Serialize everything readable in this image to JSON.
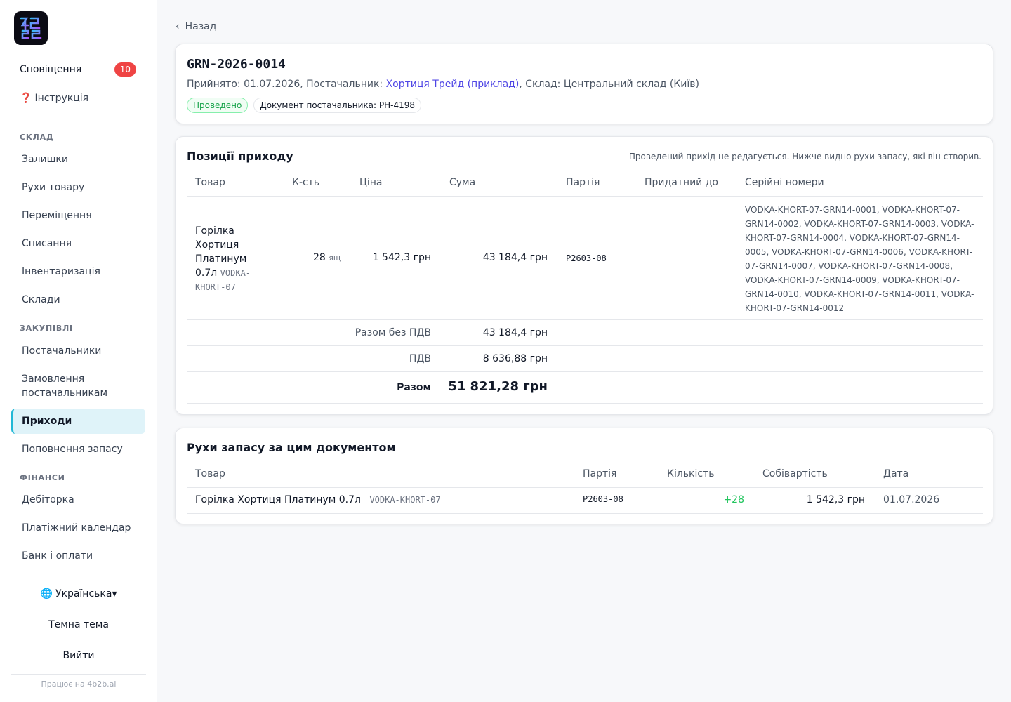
{
  "sidebar": {
    "notifications": {
      "label": "Сповіщення",
      "count": "10"
    },
    "help": {
      "icon": "❓",
      "label": "Інструкція"
    },
    "sections": {
      "warehouse": "СКЛАД",
      "purchasing": "ЗАКУПІВЛІ",
      "finance": "ФІНАНСИ"
    },
    "items": {
      "stock": "Залишки",
      "movements": "Рухи товару",
      "transfers": "Переміщення",
      "writeoffs": "Списання",
      "inventory": "Інвентаризація",
      "warehouses": "Склади",
      "suppliers": "Постачальники",
      "supplier_orders": "Замовлення постачальникам",
      "receipts": "Приходи",
      "replenishment": "Поповнення запасу",
      "receivables": "Дебіторка",
      "payment_calendar": "Платіжний календар",
      "bank": "Банк і оплати"
    },
    "language": "Українська",
    "language_caret": "▾",
    "theme": "Темна тема",
    "logout": "Вийти",
    "powered": "Працює на 4b2b.ai"
  },
  "back": "Назад",
  "document": {
    "title": "GRN-2026-0014",
    "meta_prefix": "Прийнято: 01.07.2026, Постачальник: ",
    "supplier": "Хортиця Трейд (приклад)",
    "meta_suffix": ", Склад: Центральний склад (Київ)",
    "status": "Проведено",
    "supplier_doc": "Документ постачальника: РН-4198"
  },
  "positions": {
    "title": "Позиції приходу",
    "note": "Проведений прихід не редагується. Нижче видно рухи запасу, які він створив.",
    "headers": [
      "Товар",
      "К-сть",
      "Ціна",
      "Сума",
      "Партія",
      "Придатний до",
      "Серійні номери"
    ],
    "row": {
      "product": "Горілка Хортиця Платинум 0.7л",
      "sku": "VODKA-KHORT-07",
      "qty": "28",
      "unit": "ящ",
      "price": "1 542,3 грн",
      "sum": "43 184,4 грн",
      "batch": "P2603-08",
      "expiry": "",
      "serials": "VODKA-KHORT-07-GRN14-0001, VODKA-KHORT-07-GRN14-0002, VODKA-KHORT-07-GRN14-0003, VODKA-KHORT-07-GRN14-0004, VODKA-KHORT-07-GRN14-0005, VODKA-KHORT-07-GRN14-0006, VODKA-KHORT-07-GRN14-0007, VODKA-KHORT-07-GRN14-0008, VODKA-KHORT-07-GRN14-0009, VODKA-KHORT-07-GRN14-0010, VODKA-KHORT-07-GRN14-0011, VODKA-KHORT-07-GRN14-0012"
    },
    "totals": {
      "net_label": "Разом без ПДВ",
      "net_value": "43 184,4 грн",
      "vat_label": "ПДВ",
      "vat_value": "8 636,88 грн",
      "total_label": "Разом",
      "total_value": "51 821,28 грн"
    }
  },
  "movements": {
    "title": "Рухи запасу за цим документом",
    "headers": [
      "Товар",
      "Партія",
      "Кількість",
      "Собівартість",
      "Дата"
    ],
    "row": {
      "product": "Горілка Хортиця Платинум 0.7л",
      "sku": "VODKA-KHORT-07",
      "batch": "P2603-08",
      "qty": "+28",
      "cost": "1 542,3 грн",
      "date": "01.07.2026"
    }
  },
  "colors": {
    "accent": "#22b8d6",
    "link": "#4f46e5",
    "badge": "#ef4444",
    "success": "#16a34a"
  }
}
